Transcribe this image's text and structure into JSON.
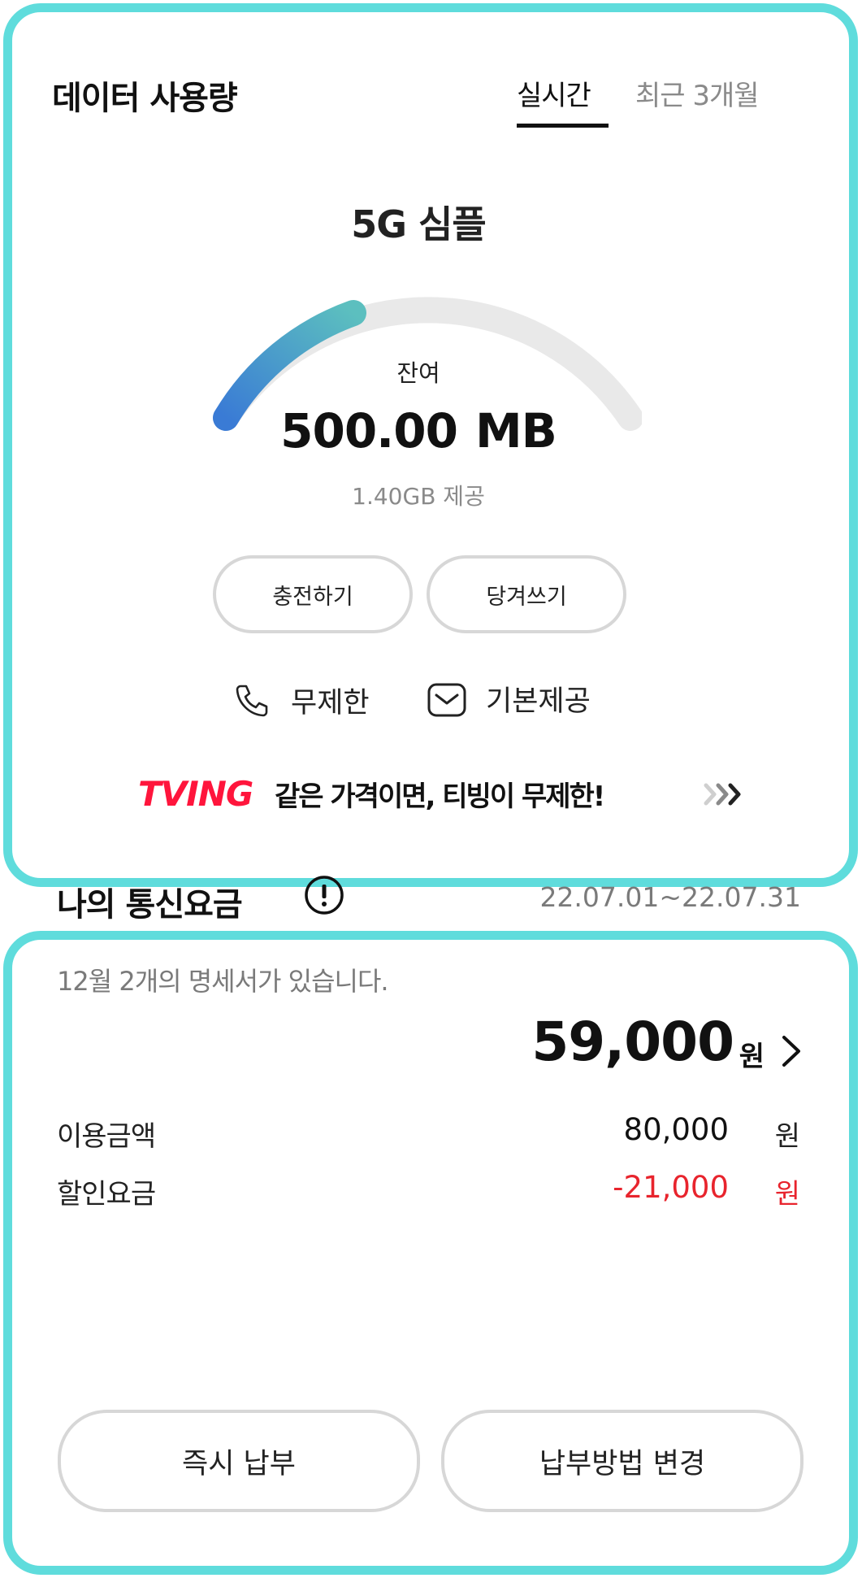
{
  "data_usage": {
    "title": "데이터 사용량",
    "tabs": [
      {
        "label": "실시간",
        "active": true
      },
      {
        "label": "최근 3개월",
        "active": false
      }
    ],
    "plan_name": "5G 심플",
    "remaining_label": "잔여",
    "remaining_amount": "500.00",
    "remaining_unit": "MB",
    "provided_text": "1.40GB 제공",
    "gauge_fill_fraction": 0.3,
    "buttons": {
      "charge": "충전하기",
      "advance": "당겨쓰기"
    },
    "voice": {
      "icon": "phone-icon",
      "label": "무제한"
    },
    "message": {
      "icon": "mail-icon",
      "label": "기본제공"
    },
    "promo": {
      "logo_text": "TVING",
      "text": "같은 가격이면, 티빙이 무제한!",
      "icon": "triple-chevron-right-icon"
    }
  },
  "bill": {
    "title": "나의 통신요금",
    "info_icon": "exclamation-circle-icon",
    "period": "22.07.01~22.07.31",
    "statement_message": "12월 2개의 명세서가 있습니다.",
    "total_amount": "59,000",
    "currency": "원",
    "rows": [
      {
        "label": "이용금액",
        "amount": "80,000",
        "unit": "원"
      },
      {
        "label": "할인요금",
        "amount": "-21,000",
        "unit": "원"
      }
    ],
    "buttons": {
      "pay_now": "즉시 납부",
      "change_method": "납부방법 변경"
    }
  },
  "colors": {
    "card_border": "#5fdcdc",
    "gauge_start": "#3a7bd5",
    "gauge_end": "#5cbfbf",
    "gauge_track": "#e9e9e9",
    "tving_red": "#ff153c",
    "discount_red": "#e8242d"
  }
}
